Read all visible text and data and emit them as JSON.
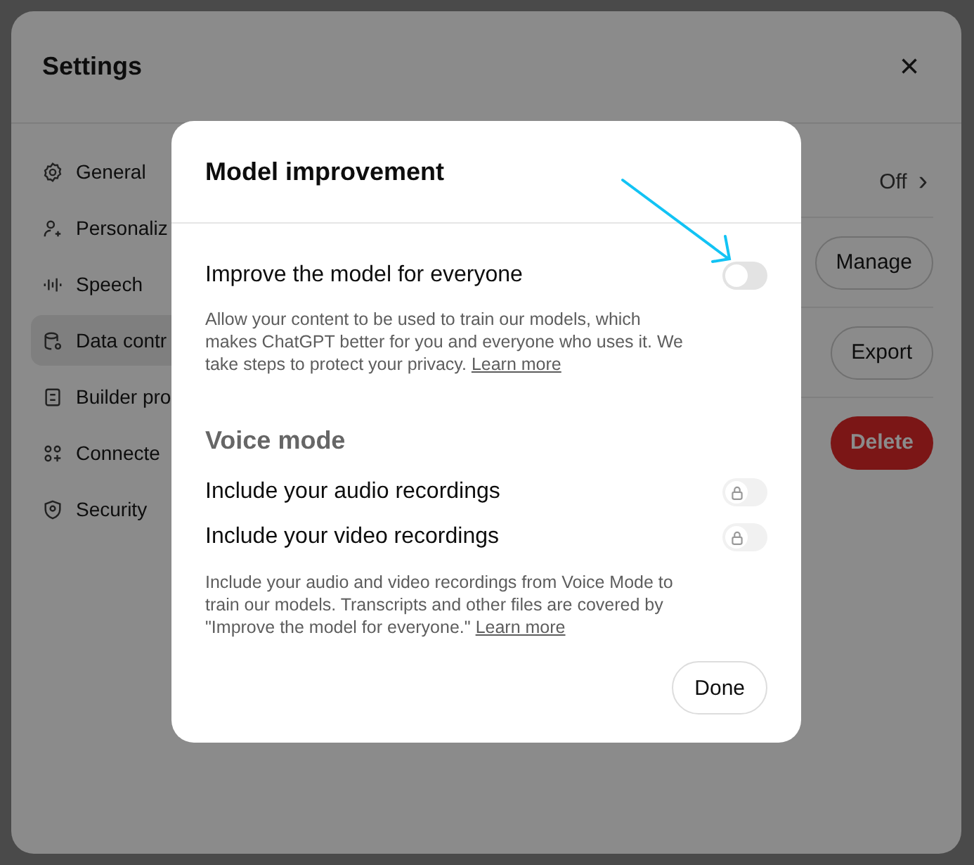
{
  "settings": {
    "title": "Settings",
    "close": "×",
    "sidebar": [
      {
        "label": "General",
        "selected": false
      },
      {
        "label": "Personaliz",
        "selected": false
      },
      {
        "label": "Speech",
        "selected": false
      },
      {
        "label": "Data contr",
        "selected": true
      },
      {
        "label": "Builder pro",
        "selected": false
      },
      {
        "label": "Connecte",
        "selected": false
      },
      {
        "label": "Security",
        "selected": false
      }
    ],
    "rows": [
      {
        "kind": "value",
        "text": "Off",
        "chevron": "›"
      },
      {
        "kind": "button",
        "text": "Manage"
      },
      {
        "kind": "button",
        "text": "Export"
      },
      {
        "kind": "danger",
        "text": "Delete"
      }
    ]
  },
  "dialog": {
    "title": "Model improvement",
    "main_toggle": {
      "label": "Improve the model for everyone",
      "on": false
    },
    "main_description": "Allow your content to be used to train our models, which makes ChatGPT better for you and everyone who uses it. We take steps to protect your privacy.",
    "main_link": "Learn more",
    "voice_heading": "Voice mode",
    "voice_toggles": [
      {
        "label": "Include your audio recordings",
        "on": false,
        "locked": true
      },
      {
        "label": "Include your video recordings",
        "on": false,
        "locked": true
      }
    ],
    "voice_description": "Include your audio and video recordings from Voice Mode to train our models. Transcripts and other files are covered by \"Improve the model for everyone.\"",
    "voice_link": "Learn more",
    "done": "Done"
  }
}
